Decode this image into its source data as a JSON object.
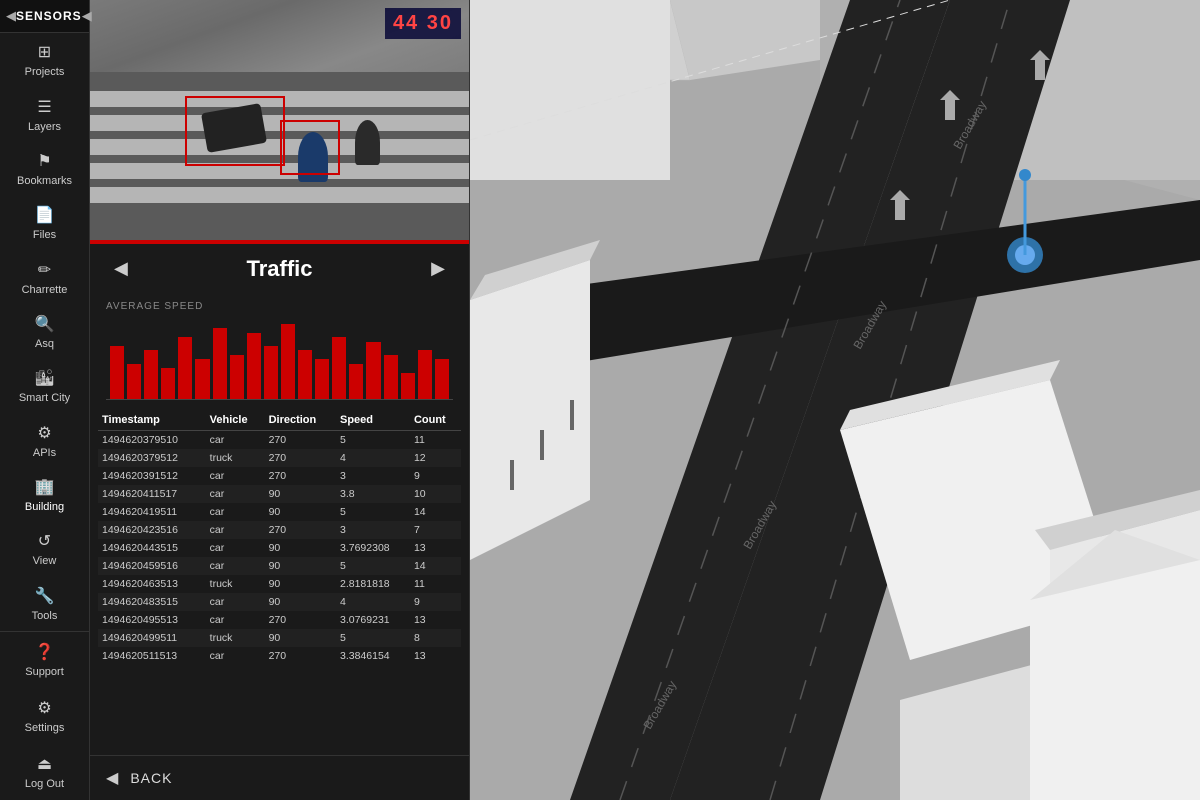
{
  "sidebar": {
    "header_icon": "◀",
    "title": "SENSORS",
    "collapse_icon": "◀",
    "items": [
      {
        "id": "projects",
        "label": "Projects",
        "icon": "⊞"
      },
      {
        "id": "layers",
        "label": "Layers",
        "icon": "☰"
      },
      {
        "id": "bookmarks",
        "label": "Bookmarks",
        "icon": "⚑"
      },
      {
        "id": "files",
        "label": "Files",
        "icon": "📄"
      },
      {
        "id": "charrette",
        "label": "Charrette",
        "icon": "✏"
      },
      {
        "id": "asq",
        "label": "Asq",
        "icon": "🔍"
      },
      {
        "id": "smart_city",
        "label": "Smart City",
        "icon": "🏙"
      },
      {
        "id": "apis",
        "label": "APIs",
        "icon": "⚙"
      },
      {
        "id": "building",
        "label": "Building",
        "icon": "🏢"
      },
      {
        "id": "view",
        "label": "View",
        "icon": "↺"
      },
      {
        "id": "tools",
        "label": "Tools",
        "icon": "🔧"
      }
    ],
    "bottom_items": [
      {
        "id": "support",
        "label": "Support",
        "icon": "❓"
      },
      {
        "id": "settings",
        "label": "Settings",
        "icon": "⚙"
      },
      {
        "id": "logout",
        "label": "Log Out",
        "icon": "⏏"
      }
    ]
  },
  "panel": {
    "title": "SENSORS",
    "camera_timestamp": "44 30",
    "red_bar_color": "#cc0000",
    "traffic_nav": {
      "prev_icon": "◀",
      "next_icon": "▶",
      "title": "Traffic"
    },
    "chart": {
      "label": "AVERAGE SPEED",
      "bars": [
        60,
        40,
        55,
        35,
        70,
        45,
        80,
        50,
        75,
        60,
        85,
        55,
        45,
        70,
        40,
        65,
        50,
        30,
        55,
        45
      ]
    },
    "table": {
      "headers": [
        "Timestamp",
        "Vehicle",
        "Direction",
        "Speed",
        "Count"
      ],
      "rows": [
        [
          "1494620379510",
          "car",
          "270",
          "5",
          "11"
        ],
        [
          "1494620379512",
          "truck",
          "270",
          "4",
          "12"
        ],
        [
          "1494620391512",
          "car",
          "270",
          "3",
          "9"
        ],
        [
          "1494620411517",
          "car",
          "90",
          "3.8",
          "10"
        ],
        [
          "1494620419511",
          "car",
          "90",
          "5",
          "14"
        ],
        [
          "1494620423516",
          "car",
          "270",
          "3",
          "7"
        ],
        [
          "1494620443515",
          "car",
          "90",
          "3.7692308",
          "13"
        ],
        [
          "1494620459516",
          "car",
          "90",
          "5",
          "14"
        ],
        [
          "1494620463513",
          "truck",
          "90",
          "2.8181818",
          "11"
        ],
        [
          "1494620483515",
          "car",
          "90",
          "4",
          "9"
        ],
        [
          "1494620495513",
          "car",
          "270",
          "3.0769231",
          "13"
        ],
        [
          "1494620499511",
          "truck",
          "90",
          "5",
          "8"
        ],
        [
          "1494620511513",
          "car",
          "270",
          "3.3846154",
          "13"
        ]
      ]
    },
    "back_button": {
      "arrow": "◀",
      "label": "BACK"
    }
  }
}
